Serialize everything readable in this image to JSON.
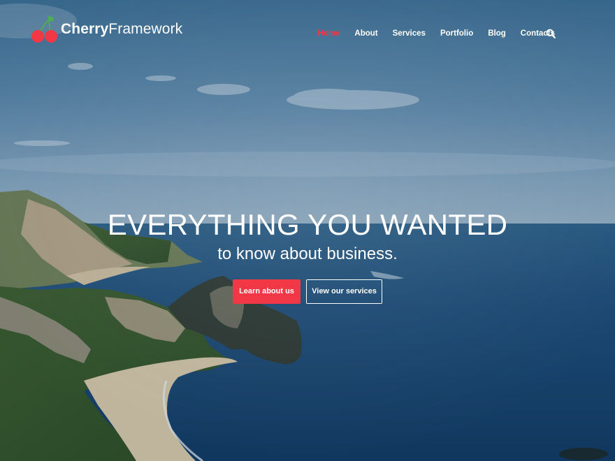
{
  "brand": {
    "name_bold": "Cherry",
    "name_light": "Framework",
    "logo_icon": "cherry-icon",
    "accent_color": "#f23847",
    "leaf_color": "#4caf50"
  },
  "nav": {
    "items": [
      {
        "label": "Home",
        "active": true
      },
      {
        "label": "About",
        "active": false
      },
      {
        "label": "Services",
        "active": false
      },
      {
        "label": "Portfolio",
        "active": false
      },
      {
        "label": "Blog",
        "active": false
      },
      {
        "label": "Contacts",
        "active": false
      }
    ],
    "search_icon": "search-icon"
  },
  "hero": {
    "title": "EVERYTHING YOU WANTED",
    "subtitle": "to know about business.",
    "primary_button": "Learn about us",
    "secondary_button": "View our services",
    "background": "coastal-cliffs-sea-photo"
  }
}
